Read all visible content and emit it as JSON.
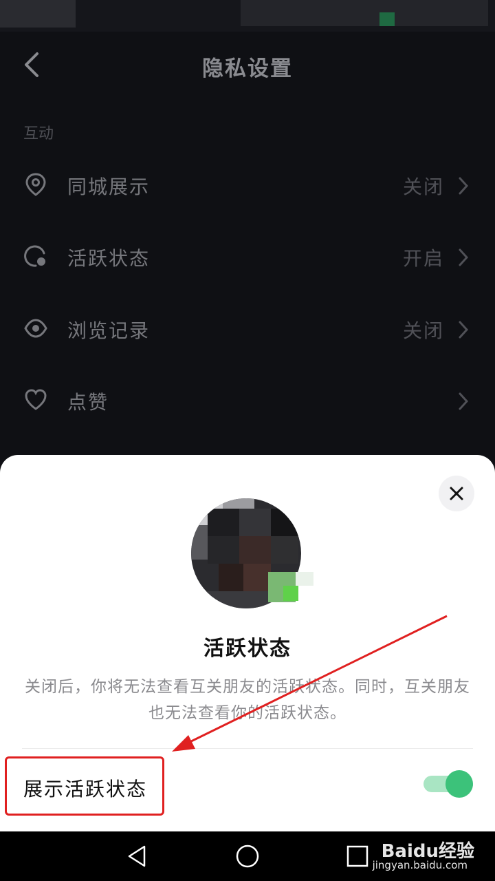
{
  "header": {
    "title": "隐私设置"
  },
  "section": {
    "label": "互动"
  },
  "rows": [
    {
      "label": "同城展示",
      "value": "关闭",
      "icon": "location-pin-icon"
    },
    {
      "label": "活跃状态",
      "value": "开启",
      "icon": "activity-status-icon"
    },
    {
      "label": "浏览记录",
      "value": "关闭",
      "icon": "eye-icon"
    },
    {
      "label": "点赞",
      "value": "",
      "icon": "heart-icon"
    }
  ],
  "sheet": {
    "title": "活跃状态",
    "description": "关闭后，你将无法查看互关朋友的活跃状态。同时，互关朋友也无法查看你的活跃状态。",
    "option_label": "展示活跃状态",
    "toggle_on": true,
    "toggle_color": "#3cc27a"
  },
  "watermark": {
    "brand": "Baidu经验",
    "url": "jingyan.baidu.com"
  },
  "colors": {
    "annotation": "#e02020",
    "background": "#0f1014"
  }
}
